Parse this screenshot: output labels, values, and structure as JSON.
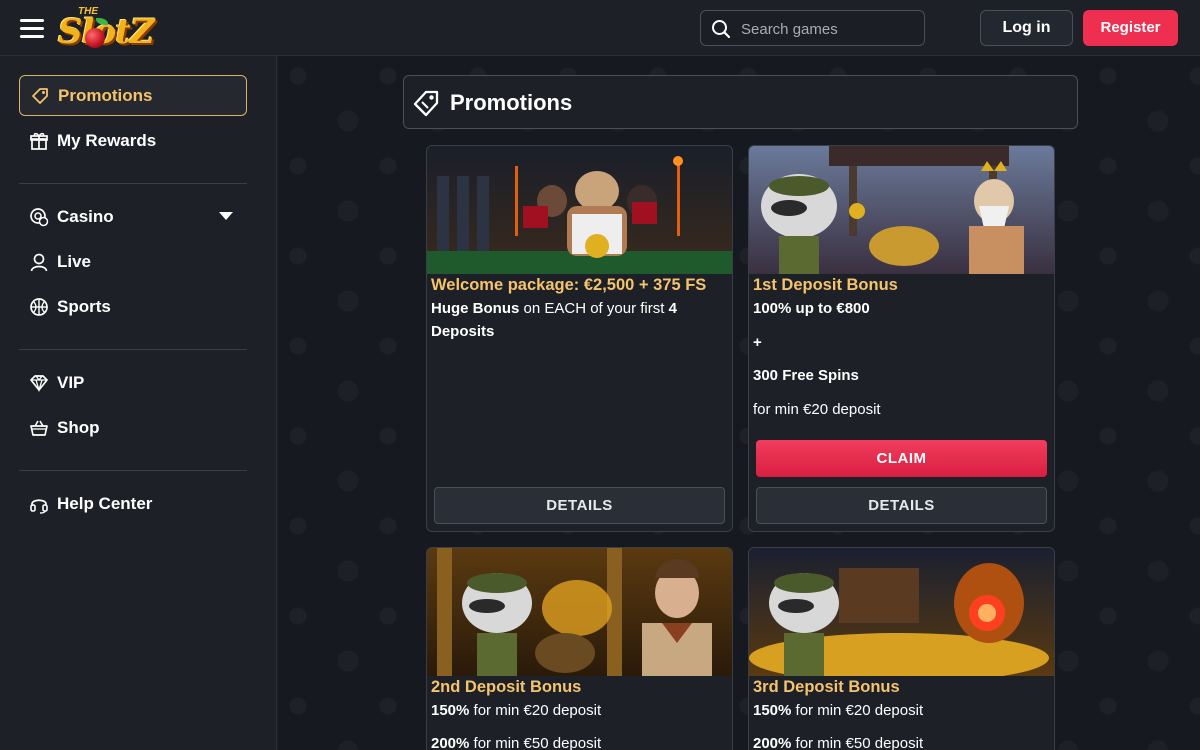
{
  "header": {
    "logo_small": "THE",
    "logo_text": "SlotZ",
    "search_placeholder": "Search games",
    "login_label": "Log in",
    "register_label": "Register"
  },
  "sidebar": {
    "items": [
      {
        "label": "Promotions",
        "icon": "tag-icon",
        "active": true
      },
      {
        "label": "My Rewards",
        "icon": "gift-icon"
      },
      {
        "label": "Casino",
        "icon": "casino-chip-icon",
        "expandable": true
      },
      {
        "label": "Live",
        "icon": "person-icon"
      },
      {
        "label": "Sports",
        "icon": "ball-icon"
      },
      {
        "label": "VIP",
        "icon": "diamond-icon"
      },
      {
        "label": "Shop",
        "icon": "basket-icon"
      },
      {
        "label": "Help Center",
        "icon": "headset-icon"
      }
    ]
  },
  "main": {
    "title": "Promotions",
    "cards": [
      {
        "title": "Welcome package: €2,500 + 375 FS",
        "line1_bold": "Huge Bonus",
        "line1_rest": " on EACH of your first ",
        "line1_num": "4",
        "line2": "Deposits",
        "details_label": "DETAILS"
      },
      {
        "title": "1st Deposit Bonus",
        "line1": "100% up to €800",
        "line2": "+",
        "line3": "300 Free Spins",
        "line4": "for min €20 deposit",
        "claim_label": "CLAIM",
        "details_label": "DETAILS"
      },
      {
        "title": "2nd Deposit Bonus",
        "line1_bold": "150%",
        "line1_rest": " for min €20 deposit",
        "line2_bold": "200%",
        "line2_rest": " for min €50 deposit"
      },
      {
        "title": "3rd Deposit Bonus",
        "line1_bold": "150%",
        "line1_rest": " for min €20 deposit",
        "line2_bold": "200%",
        "line2_rest": " for min €50 deposit"
      }
    ]
  },
  "colors": {
    "accent_gold": "#f5c36b",
    "register_red": "#ee2f4f",
    "claim_red": "#e62b4c",
    "background": "#16191f"
  }
}
